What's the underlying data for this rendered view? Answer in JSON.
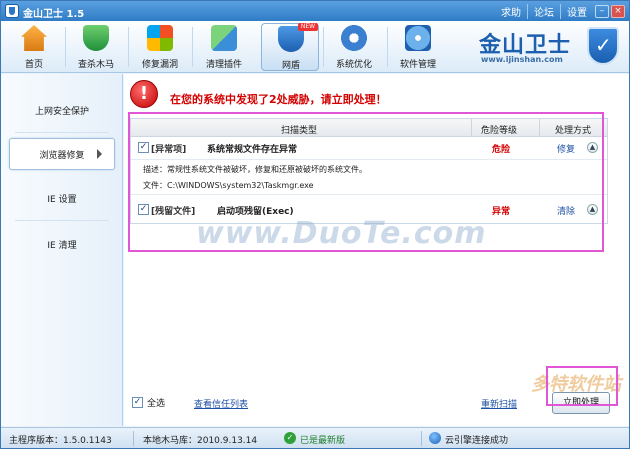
{
  "window": {
    "title": "金山卫士 1.5",
    "links": [
      "求助",
      "论坛",
      "设置"
    ]
  },
  "toolbar": {
    "items": [
      {
        "label": "首页",
        "icon": "home-icon"
      },
      {
        "label": "查杀木马",
        "icon": "trojan-shield-icon"
      },
      {
        "label": "修复漏洞",
        "icon": "windows-patch-icon"
      },
      {
        "label": "清理插件",
        "icon": "broom-icon"
      },
      {
        "label": "网盾",
        "icon": "net-shield-icon",
        "active": true,
        "badge": "NEW"
      },
      {
        "label": "系统优化",
        "icon": "gear-icon"
      },
      {
        "label": "软件管理",
        "icon": "software-disc-icon"
      }
    ],
    "logo": {
      "brand": "金山卫士",
      "url": "www.ijinshan.com"
    }
  },
  "sidebar": {
    "items": [
      {
        "label": "上网安全保护"
      },
      {
        "label": "浏览器修复",
        "selected": true
      },
      {
        "label": "IE 设置"
      },
      {
        "label": "IE 清理"
      }
    ]
  },
  "alert": {
    "text": "在您的系统中发现了2处威胁，请立即处理！"
  },
  "table": {
    "headers": [
      "扫描类型",
      "危险等级",
      "处理方式"
    ],
    "rows": [
      {
        "tag": "[异常项]",
        "desc": "系统常规文件存在异常",
        "level": "危险",
        "action": "修复",
        "checked": true
      },
      {
        "tag": "[残留文件]",
        "desc": "启动项残留(Exec)",
        "level": "异常",
        "action": "清除",
        "checked": true
      }
    ],
    "detail": {
      "line1": "描述：常规性系统文件被破坏，修复和还原被破坏的系统文件。",
      "line2": "文件：C:\\WINDOWS\\system32\\Taskmgr.exe"
    }
  },
  "bottom": {
    "select_all": "全选",
    "trust_list": "查看信任列表",
    "rescan": "重新扫描",
    "fix_now": "立即处理"
  },
  "status": {
    "version": "主程序版本：1.5.0.1143",
    "db": "本地木马库：2010.9.13.14",
    "latest": "已是最新版",
    "cloud": "云引擎连接成功"
  },
  "watermarks": {
    "main": "www.DuoTe.com",
    "corner": "多特软件站"
  }
}
